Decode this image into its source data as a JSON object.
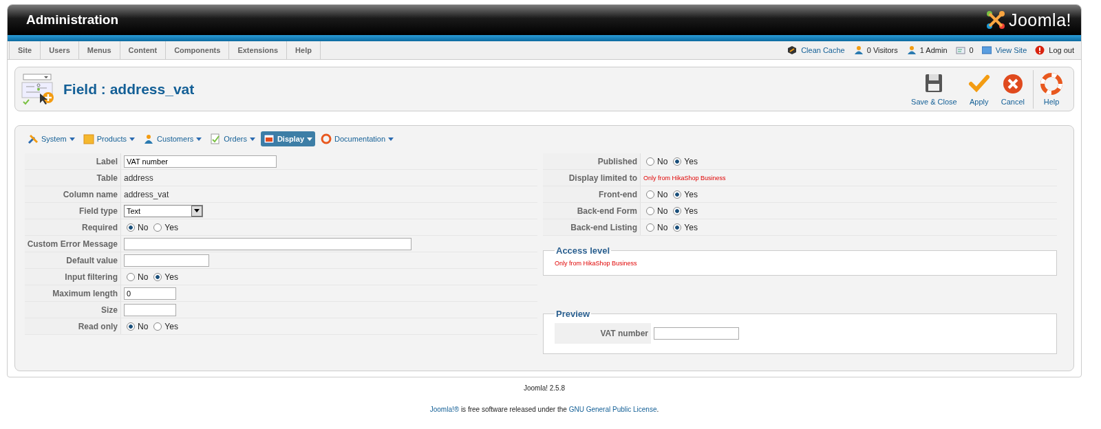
{
  "header": {
    "title": "Administration",
    "logo_text": "Joomla!"
  },
  "menu": {
    "items": [
      "Site",
      "Users",
      "Menus",
      "Content",
      "Components",
      "Extensions",
      "Help"
    ],
    "status": [
      {
        "kind": "cache",
        "text": "Clean Cache",
        "link": true
      },
      {
        "kind": "visitors",
        "text": "0 Visitors",
        "link": false
      },
      {
        "kind": "admins",
        "text": "1 Admin",
        "link": false
      },
      {
        "kind": "messages",
        "text": "0",
        "link": false
      },
      {
        "kind": "site",
        "text": "View Site",
        "link": true
      },
      {
        "kind": "logout",
        "text": "Log out",
        "link": false
      }
    ]
  },
  "page_title": "Field : address_vat",
  "toolbar": [
    {
      "kind": "save",
      "label": "Save & Close"
    },
    {
      "kind": "apply",
      "label": "Apply"
    },
    {
      "kind": "cancel",
      "label": "Cancel"
    },
    {
      "kind": "help",
      "label": "Help"
    }
  ],
  "submenu": [
    {
      "kind": "system",
      "label": "System",
      "selected": false
    },
    {
      "kind": "products",
      "label": "Products",
      "selected": false
    },
    {
      "kind": "customers",
      "label": "Customers",
      "selected": false
    },
    {
      "kind": "orders",
      "label": "Orders",
      "selected": false
    },
    {
      "kind": "display",
      "label": "Display",
      "selected": true
    },
    {
      "kind": "docs",
      "label": "Documentation",
      "selected": false
    }
  ],
  "left_fields": [
    {
      "label": "Label",
      "kind": "input",
      "value": "VAT number"
    },
    {
      "label": "Table",
      "kind": "static",
      "value": "address"
    },
    {
      "label": "Column name",
      "kind": "static",
      "value": "address_vat"
    },
    {
      "label": "Field type",
      "kind": "select",
      "value": "Text"
    },
    {
      "label": "Required",
      "kind": "radio",
      "options": [
        {
          "label": "No",
          "selected": true
        },
        {
          "label": "Yes",
          "selected": false
        }
      ]
    },
    {
      "label": "Custom Error Message",
      "kind": "input"
    },
    {
      "label": "Default value",
      "kind": "input"
    },
    {
      "label": "Input filtering",
      "kind": "radio",
      "options": [
        {
          "label": "No",
          "selected": false
        },
        {
          "label": "Yes",
          "selected": true
        }
      ]
    },
    {
      "label": "Maximum length",
      "kind": "input",
      "value": "0"
    },
    {
      "label": "Size",
      "kind": "input"
    },
    {
      "label": "Read only",
      "kind": "radio",
      "options": [
        {
          "label": "No",
          "selected": true
        },
        {
          "label": "Yes",
          "selected": false
        }
      ]
    }
  ],
  "right_fields": [
    {
      "label": "Published",
      "kind": "radio",
      "options": [
        {
          "label": "No",
          "selected": false
        },
        {
          "label": "Yes",
          "selected": true
        }
      ]
    },
    {
      "label": "Display limited to",
      "kind": "note",
      "value": "Only from HikaShop Business"
    },
    {
      "label": "Front-end",
      "kind": "radio",
      "options": [
        {
          "label": "No",
          "selected": false
        },
        {
          "label": "Yes",
          "selected": true
        }
      ]
    },
    {
      "label": "Back-end Form",
      "kind": "radio",
      "options": [
        {
          "label": "No",
          "selected": false
        },
        {
          "label": "Yes",
          "selected": true
        }
      ]
    },
    {
      "label": "Back-end Listing",
      "kind": "radio",
      "options": [
        {
          "label": "No",
          "selected": false
        },
        {
          "label": "Yes",
          "selected": true
        }
      ]
    }
  ],
  "access_level": {
    "legend": "Access level",
    "note": "Only from HikaShop Business"
  },
  "preview": {
    "legend": "Preview",
    "label": "VAT number"
  },
  "footer": {
    "version": "Joomla! 2.5.8",
    "license": [
      {
        "kind": "link",
        "text": "Joomla!®"
      },
      {
        "kind": "text",
        "text": " is free software released under the "
      },
      {
        "kind": "link",
        "text": "GNU General Public License"
      },
      {
        "kind": "text",
        "text": "."
      }
    ]
  }
}
